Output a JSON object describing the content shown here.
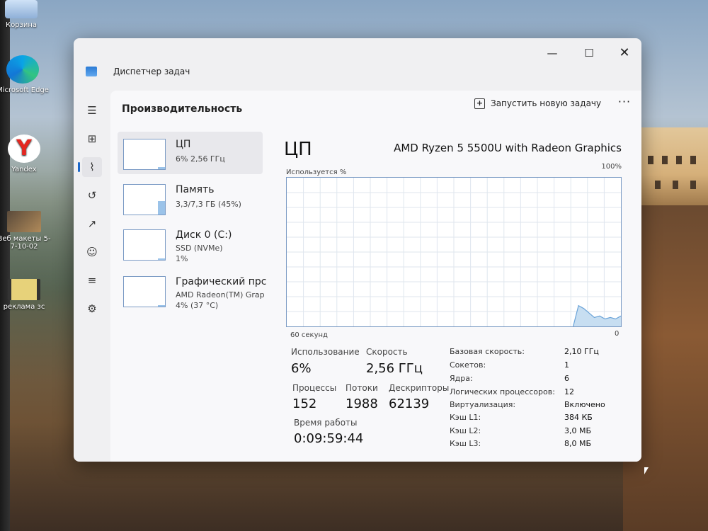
{
  "desktop": {
    "icons": [
      {
        "label": "Корзина"
      },
      {
        "label": "Microsoft Edge"
      },
      {
        "label": "Yandex"
      },
      {
        "label": "Веб макеты 5-7-10-02"
      },
      {
        "label": "реклама зс"
      }
    ],
    "yandex_letter": "Y"
  },
  "window": {
    "title": "Диспетчер задач",
    "controls": {
      "minimize": "—",
      "maximize": "☐",
      "close": "✕"
    }
  },
  "nav": {
    "items": [
      {
        "name": "menu-icon",
        "glyph": "☰"
      },
      {
        "name": "processes-icon",
        "glyph": "⊞"
      },
      {
        "name": "performance-icon",
        "glyph": "⌇"
      },
      {
        "name": "app-history-icon",
        "glyph": "↺"
      },
      {
        "name": "startup-icon",
        "glyph": "↗"
      },
      {
        "name": "users-icon",
        "glyph": "☺"
      },
      {
        "name": "details-icon",
        "glyph": "≡"
      },
      {
        "name": "services-icon",
        "glyph": "⚙"
      }
    ],
    "settings_glyph": "⚙"
  },
  "header": {
    "section_title": "Производительность",
    "run_task_label": "Запустить новую задачу",
    "more_label": "···"
  },
  "resources": [
    {
      "name": "ЦП",
      "line1": "6%  2,56 ГГц",
      "line2": "",
      "usage": 0.06
    },
    {
      "name": "Память",
      "line1": "3,3/7,3 ГБ (45%)",
      "line2": "",
      "usage": 0.45
    },
    {
      "name": "Диск 0 (C:)",
      "line1": "SSD (NVMe)",
      "line2": "1%",
      "usage": 0.01
    },
    {
      "name": "Графический прс",
      "line1": "AMD Radeon(TM) Grap",
      "line2": "4% (37 °C)",
      "usage": 0.04
    }
  ],
  "detail": {
    "title": "ЦП",
    "model": "AMD Ryzen 5 5500U with Radeon Graphics",
    "usage_axis_label": "Используется %",
    "max_label": "100%",
    "time_label": "60 секунд",
    "min_label": "0",
    "usage_history": [
      0,
      0,
      0,
      0,
      0,
      0,
      0,
      0,
      0,
      0,
      0,
      0,
      0,
      0,
      0,
      0,
      0,
      0,
      0,
      0,
      0,
      0,
      0,
      0,
      0,
      0,
      0,
      0,
      0,
      0,
      0,
      0,
      0,
      0,
      0,
      0,
      0,
      0,
      0,
      0,
      0,
      0,
      0,
      0,
      0,
      0,
      0,
      0,
      0,
      0,
      0,
      0,
      0,
      0,
      0,
      14,
      12,
      9,
      6,
      7,
      5,
      6,
      5,
      7
    ]
  },
  "stats": {
    "usage": {
      "label": "Использование",
      "value": "6%"
    },
    "speed": {
      "label": "Скорость",
      "value": "2,56 ГГц"
    },
    "processes": {
      "label": "Процессы",
      "value": "152"
    },
    "threads": {
      "label": "Потоки",
      "value": "1988"
    },
    "handles": {
      "label": "Дескрипторы",
      "value": "62139"
    },
    "uptime": {
      "label": "Время работы",
      "value": "0:09:59:44"
    }
  },
  "specs": [
    {
      "key": "Базовая скорость:",
      "value": "2,10 ГГц"
    },
    {
      "key": "Сокетов:",
      "value": "1"
    },
    {
      "key": "Ядра:",
      "value": "6"
    },
    {
      "key": "Логических процессоров:",
      "value": "12"
    },
    {
      "key": "Виртуализация:",
      "value": "Включено"
    },
    {
      "key": "Кэш L1:",
      "value": "384 КБ"
    },
    {
      "key": "Кэш L2:",
      "value": "3,0 МБ"
    },
    {
      "key": "Кэш L3:",
      "value": "8,0 МБ"
    }
  ],
  "colors": {
    "accent": "#1a67c9",
    "graph_fill": "#c7def1",
    "graph_line": "#6aa3d8",
    "grid": "#dfe6ee"
  }
}
